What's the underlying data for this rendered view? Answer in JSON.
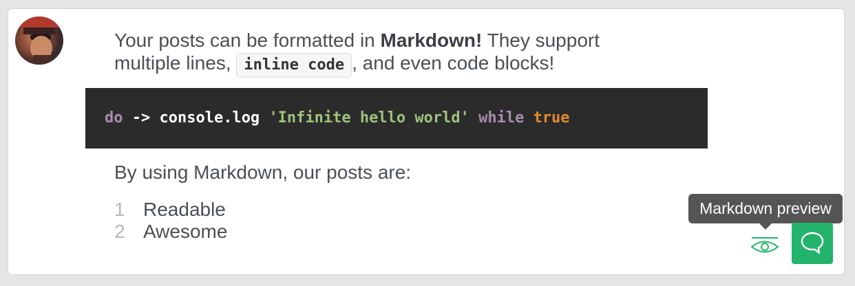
{
  "post": {
    "line1_prefix": "Your posts can be formatted in ",
    "line1_bold": "Markdown!",
    "line1_suffix": " They support",
    "line2_prefix": "multiple lines, ",
    "inline_code": "inline code",
    "line2_suffix": ", and even code blocks!",
    "code": {
      "t1": "do",
      "t2": " -> ",
      "t3": "console.log ",
      "t4": "'Infinite hello world'",
      "t5": " while ",
      "t6": "true"
    },
    "lead": "By using Markdown, our posts are:",
    "list": [
      {
        "num": "1",
        "text": "Readable"
      },
      {
        "num": "2",
        "text": "Awesome"
      }
    ]
  },
  "tooltip": {
    "text": "Markdown preview"
  },
  "icons": {
    "preview": "eye-icon",
    "comment": "speech-bubble-icon"
  },
  "colors": {
    "accent": "#23b36b",
    "code_bg": "#2b2b2b",
    "tooltip_bg": "#555555"
  }
}
